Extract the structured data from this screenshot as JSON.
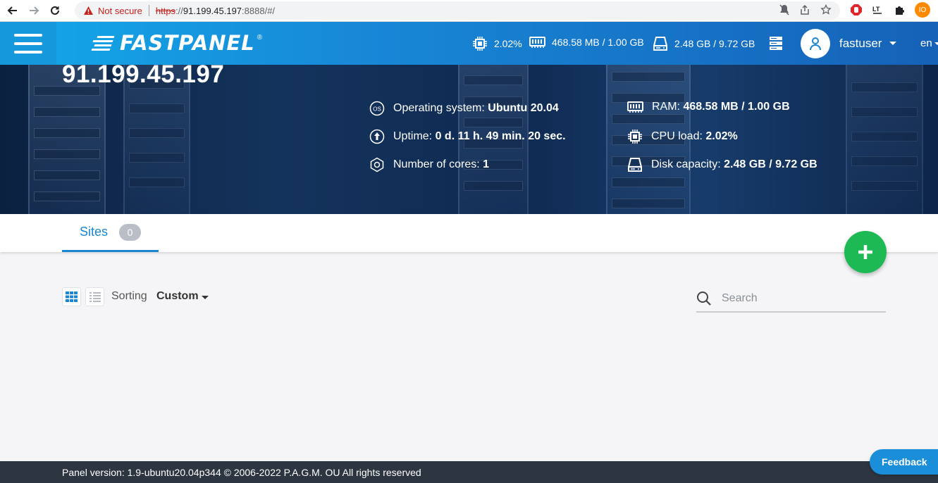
{
  "browser": {
    "security_label": "Not secure",
    "url_scheme": "https",
    "url_sep": "://",
    "url_host": "91.199.45.197",
    "url_rest": ":8888/#/",
    "profile_initials": "IO"
  },
  "header": {
    "logo_text": "FASTPANEL",
    "logo_reg": "®",
    "cpu": "2.02%",
    "ram": "468.58 MB / 1.00 GB",
    "disk": "2.48 GB / 9.72 GB",
    "username": "fastuser",
    "language": "en"
  },
  "hero": {
    "ip": "91.199.45.197",
    "os_label": "Operating system:",
    "os_value": "Ubuntu 20.04",
    "uptime_label": "Uptime:",
    "uptime_value": "0 d. 11 h. 49 min. 20 sec.",
    "cores_label": "Number of cores:",
    "cores_value": "1",
    "ram_label": "RAM:",
    "ram_value": "468.58 MB / 1.00 GB",
    "cpu_label": "CPU load:",
    "cpu_value": "2.02%",
    "disk_label": "Disk capacity:",
    "disk_value": "2.48 GB / 9.72 GB",
    "os_icon_text": "OS"
  },
  "tabs": [
    {
      "label": "Sites",
      "count": "0"
    }
  ],
  "toolbar": {
    "sorting_label": "Sorting",
    "sorting_value": "Custom",
    "search_placeholder": "Search"
  },
  "footer": {
    "text": "Panel version: 1.9-ubuntu20.04p344 © 2006-2022 P.A.G.M. OU All rights reserved"
  },
  "feedback_label": "Feedback",
  "colors": {
    "accent": "#1a85d0",
    "fab": "#1db954",
    "footer_bg": "#2c3540"
  }
}
